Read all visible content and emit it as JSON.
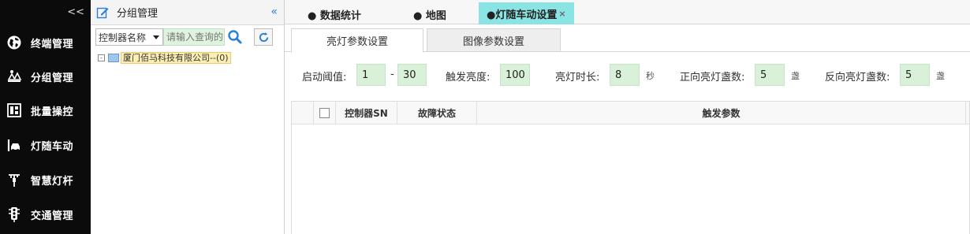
{
  "nav": {
    "collapse": "<<",
    "items": [
      {
        "label": "终端管理",
        "icon": "globe-icon"
      },
      {
        "label": "分组管理",
        "icon": "group-icon"
      },
      {
        "label": "批量操控",
        "icon": "batch-control-icon"
      },
      {
        "label": "灯随车动",
        "icon": "car-light-icon"
      },
      {
        "label": "智慧灯杆",
        "icon": "smart-pole-icon"
      },
      {
        "label": "交通管理",
        "icon": "traffic-light-icon"
      }
    ]
  },
  "group_panel": {
    "title": "分组管理",
    "collapse": "«",
    "select_value": "控制器名称",
    "search_placeholder": "请输入查询的",
    "tree_toggle": "-",
    "tree_node": "厦门佰马科技有限公司--(0)"
  },
  "tabs": [
    {
      "label": "● 数据统计"
    },
    {
      "label": "● 地图"
    },
    {
      "label": "●灯随车动设置",
      "close": "×",
      "active": true
    }
  ],
  "subtabs": [
    {
      "label": "亮灯参数设置",
      "active": true
    },
    {
      "label": "图像参数设置",
      "active": false
    }
  ],
  "params": {
    "threshold_label": "启动阈值:",
    "threshold_min": "1",
    "dash": "-",
    "threshold_max": "30",
    "brightness_label": "触发亮度:",
    "brightness": "100",
    "duration_label": "亮灯时长:",
    "duration": "8",
    "duration_unit": "秒",
    "forward_label": "正向亮灯盏数:",
    "forward": "5",
    "forward_unit": "盏",
    "reverse_label": "反向亮灯盏数:",
    "reverse": "5",
    "reverse_unit": "盏"
  },
  "table": {
    "columns": [
      "控制器SN",
      "故障状态",
      "触发参数"
    ]
  },
  "colors": {
    "nav_bg": "#0b0b0b",
    "active_tab": "#8be4e4",
    "input_bg": "#d9f0d9",
    "accent": "#2b7fd6"
  }
}
